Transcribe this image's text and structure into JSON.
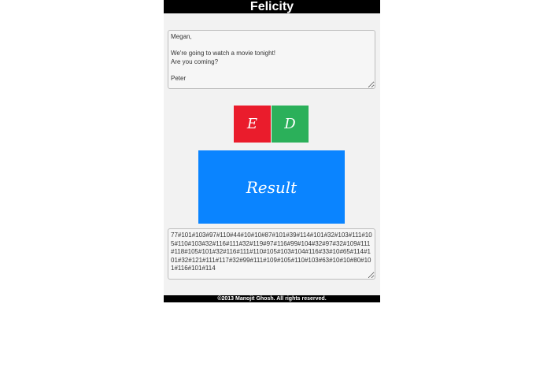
{
  "header": {
    "title": "Felicity"
  },
  "input": {
    "value": "Megan,\n\nWe're going to watch a movie tonight!\nAre you coming?\n\nPeter"
  },
  "buttons": {
    "encode_label": "E",
    "decode_label": "D",
    "result_label": "Result"
  },
  "output": {
    "value": "77#101#103#97#110#44#10#10#87#101#39#114#101#32#103#111#105#110#103#32#116#111#32#119#97#116#99#104#32#97#32#109#111#118#105#101#32#116#111#110#105#103#104#116#33#10#65#114#101#32#121#111#117#32#99#111#109#105#110#103#63#10#10#80#101#116#101#114"
  },
  "footer": {
    "text": "©2013 Manojit Ghosh. All rights reserved."
  },
  "colors": {
    "header_bg": "#000000",
    "encode": "#ea1c2c",
    "decode": "#2bb05a",
    "result": "#0a84ff"
  }
}
